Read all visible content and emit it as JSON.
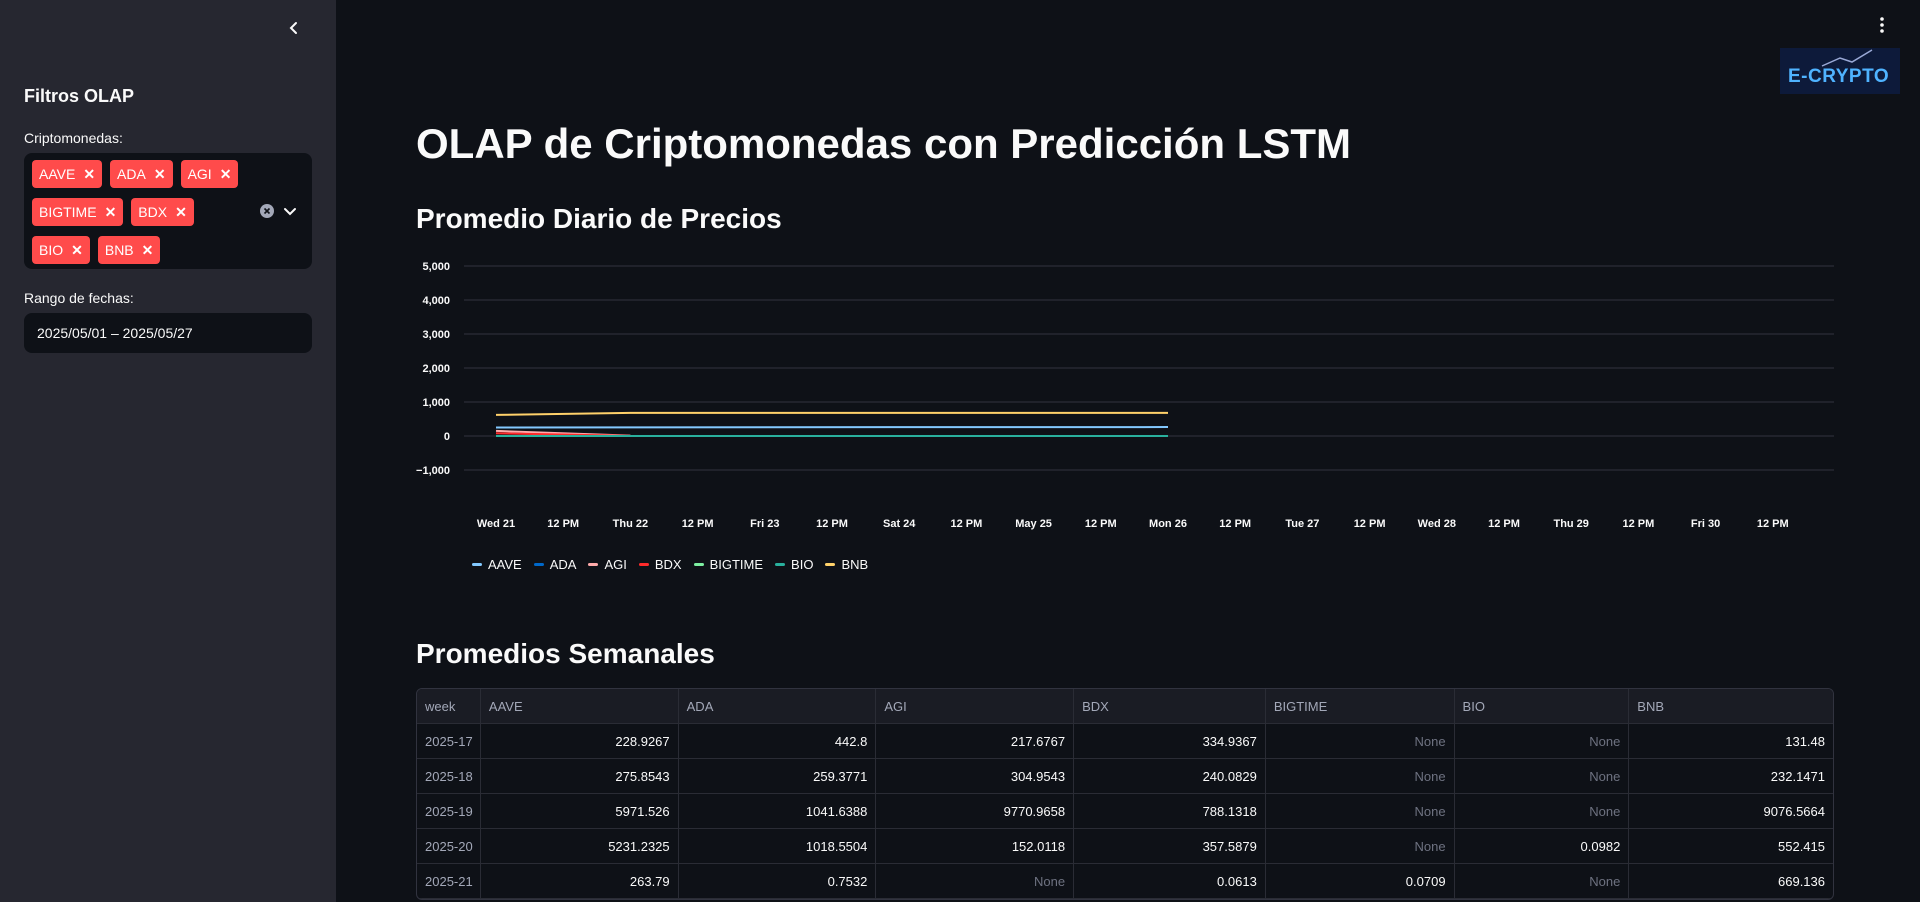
{
  "sidebar": {
    "title": "Filtros OLAP",
    "crypto_label": "Criptomonedas:",
    "tags": [
      "AAVE",
      "ADA",
      "AGI",
      "BIGTIME",
      "BDX",
      "BIO",
      "BNB"
    ],
    "date_label": "Rango de fechas:",
    "date_value": "2025/05/01 – 2025/05/27"
  },
  "logo_text": "E-CRYPTO",
  "main": {
    "title": "OLAP de Criptomonedas con Predicción LSTM",
    "chart_title": "Promedio Diario de Precios",
    "table_title": "Promedios Semanales"
  },
  "chart_data": {
    "type": "line",
    "ylim": [
      -1000,
      5000
    ],
    "y_ticks": [
      "5,000",
      "4,000",
      "3,000",
      "2,000",
      "1,000",
      "0",
      "−1,000"
    ],
    "x_ticks": [
      "Wed 21",
      "12 PM",
      "Thu 22",
      "12 PM",
      "Fri 23",
      "12 PM",
      "Sat 24",
      "12 PM",
      "May 25",
      "12 PM",
      "Mon 26",
      "12 PM",
      "Tue 27",
      "12 PM",
      "Wed 28",
      "12 PM",
      "Thu 29",
      "12 PM",
      "Fri 30",
      "12 PM"
    ],
    "x": [
      "2025-05-21",
      "2025-05-22",
      "2025-05-23",
      "2025-05-24",
      "2025-05-25",
      "2025-05-26"
    ],
    "series": [
      {
        "name": "AAVE",
        "color": "#83c9ff",
        "values": [
          250,
          255,
          258,
          260,
          262,
          263
        ]
      },
      {
        "name": "ADA",
        "color": "#0068c9",
        "values": [
          0.75,
          0.75,
          0.75,
          0.75,
          0.75,
          0.75
        ]
      },
      {
        "name": "AGI",
        "color": "#ffabab",
        "values": [
          150,
          10,
          null,
          null,
          null,
          null
        ]
      },
      {
        "name": "BDX",
        "color": "#ff2b2b",
        "values": [
          80,
          5,
          null,
          null,
          null,
          null
        ]
      },
      {
        "name": "BIGTIME",
        "color": "#7defa1",
        "values": [
          0.07,
          0.07,
          0.07,
          0.07,
          0.07,
          0.07
        ]
      },
      {
        "name": "BIO",
        "color": "#29b09d",
        "values": [
          0.09,
          0.09,
          0.09,
          0.09,
          0.09,
          0.09
        ]
      },
      {
        "name": "BNB",
        "color": "#ffd16a",
        "values": [
          620,
          680,
          680,
          680,
          680,
          680
        ]
      }
    ],
    "grid": true,
    "legend": "bottom-left"
  },
  "table": {
    "columns": [
      "week",
      "AAVE",
      "ADA",
      "AGI",
      "BDX",
      "BIGTIME",
      "BIO",
      "BNB"
    ],
    "rows": [
      [
        "2025-17",
        "228.9267",
        "442.8",
        "217.6767",
        "334.9367",
        "None",
        "None",
        "131.48"
      ],
      [
        "2025-18",
        "275.8543",
        "259.3771",
        "304.9543",
        "240.0829",
        "None",
        "None",
        "232.1471"
      ],
      [
        "2025-19",
        "5971.526",
        "1041.6388",
        "9770.9658",
        "788.1318",
        "None",
        "None",
        "9076.5664"
      ],
      [
        "2025-20",
        "5231.2325",
        "1018.5504",
        "152.0118",
        "357.5879",
        "None",
        "0.0982",
        "552.415"
      ],
      [
        "2025-21",
        "263.79",
        "0.7532",
        "None",
        "0.0613",
        "0.0709",
        "None",
        "669.136"
      ]
    ]
  }
}
